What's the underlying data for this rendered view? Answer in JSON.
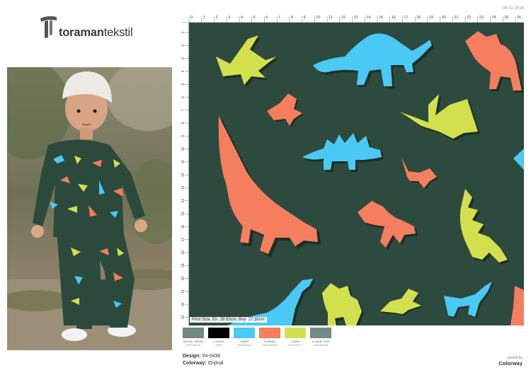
{
  "brand": {
    "name_bold": "toraman",
    "name_light": "tekstil"
  },
  "date": "06.02.2024",
  "rulers": {
    "top": [
      "0",
      "1",
      "2",
      "3",
      "4",
      "5",
      "6",
      "7",
      "8",
      "9",
      "10",
      "11",
      "12",
      "13",
      "14",
      "15",
      "16",
      "17",
      "18",
      "19",
      "20",
      "21",
      "22",
      "23",
      "24",
      "25",
      "26"
    ],
    "left": [
      "1",
      "2",
      "3",
      "4",
      "5",
      "6",
      "7",
      "8",
      "9",
      "10",
      "11",
      "12",
      "13",
      "14",
      "15",
      "16",
      "17",
      "18",
      "19",
      "20",
      "21",
      "22",
      "23"
    ]
  },
  "print_size": "Print Size, En: 29.83cm, Boy: 27.30cm",
  "swatches": [
    {
      "name": "BOYALI ZEMIN",
      "code": "115/140/131",
      "color": "#6e8a7c"
    },
    {
      "name": "1-SIYAH",
      "code": "0/0/0",
      "color": "#000000"
    },
    {
      "name": "2-MAVI",
      "code": "74/201/244",
      "color": "#4ac9f4"
    },
    {
      "name": "3-ORANJ",
      "code": "244/126/94",
      "color": "#f47e5e"
    },
    {
      "name": "4-SARI",
      "code": "211/224/77",
      "color": "#d3e04d"
    },
    {
      "name": "5-LAVIE FON",
      "code": "115/140/131",
      "color": "#738c83"
    }
  ],
  "design": {
    "label": "Design:",
    "value": "04-0436"
  },
  "colorway": {
    "label": "Colorway:",
    "value": "Orijinal"
  },
  "served": {
    "by": "served by",
    "brand": "Colorway"
  },
  "colors": {
    "background": "#2d4a3e",
    "blue": "#4ac9f4",
    "orange": "#f47e5e",
    "yellow": "#d3e04d",
    "dark": "#1d2e27"
  }
}
